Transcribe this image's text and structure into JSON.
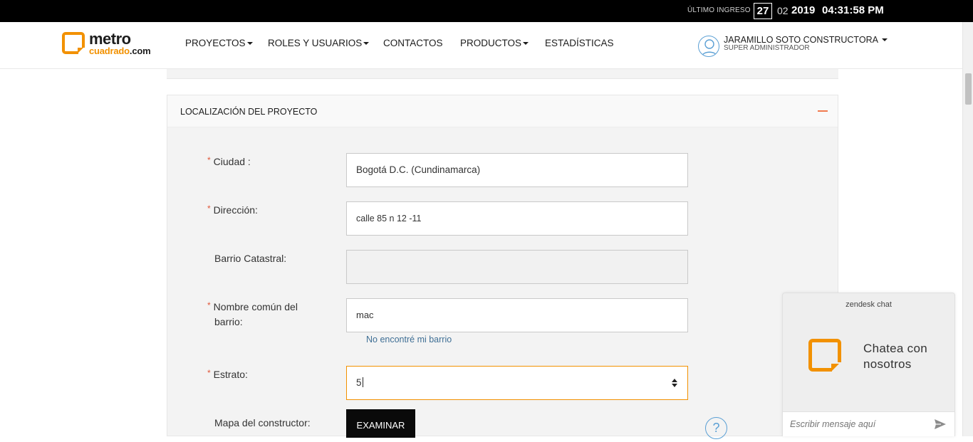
{
  "topbar": {
    "last_login_label": "ÚLTIMO INGRESO",
    "day": "27",
    "month": "02",
    "year": "2019",
    "time": "04:31:58 PM"
  },
  "header": {
    "logo": {
      "top": "metro",
      "bottom": "cuadrado",
      "suffix": ".com"
    },
    "nav": [
      {
        "label": "PROYECTOS",
        "dropdown": true
      },
      {
        "label": "ROLES Y USUARIOS",
        "dropdown": true
      },
      {
        "label": "CONTACTOS",
        "dropdown": false
      },
      {
        "label": "PRODUCTOS",
        "dropdown": true
      },
      {
        "label": "ESTADÍSTICAS",
        "dropdown": false
      }
    ],
    "user": {
      "name": "JARAMILLO SOTO CONSTRUCTORA",
      "role": "SUPER ADMINISTRADOR",
      "avatar_icon": "user-outline-icon"
    }
  },
  "panel": {
    "title": "LOCALIZACIÓN DEL PROYECTO",
    "collapse_icon": "minus-icon",
    "fields": {
      "ciudad": {
        "label": "Ciudad :",
        "required": "*",
        "value": "Bogotá D.C. (Cundinamarca)"
      },
      "direccion": {
        "label": "Dirección:",
        "required": "*",
        "value": "calle 85 n 12 -11"
      },
      "barrio_catastral": {
        "label": "Barrio Catastral:",
        "value": ""
      },
      "nombre_barrio": {
        "label_line1": "Nombre común del",
        "label_line2": "barrio:",
        "required": "*",
        "value": "mac"
      },
      "estrato": {
        "label": "Estrato:",
        "required": "*",
        "value": "5"
      },
      "mapa": {
        "label": "Mapa del constructor:"
      }
    },
    "not_found_link": "No encontré mi barrio",
    "examinar_button": "EXAMINAR",
    "help_icon": "?"
  },
  "chat": {
    "brand": "zendesk chat",
    "title": "Chatea con nosotros",
    "input_placeholder": "Escribir mensaje aquí",
    "send_icon": "send-icon"
  },
  "colors": {
    "accent": "#f29100",
    "required": "#e0573a",
    "link": "#3f6f95",
    "panel_bg": "#f3f3f3"
  }
}
